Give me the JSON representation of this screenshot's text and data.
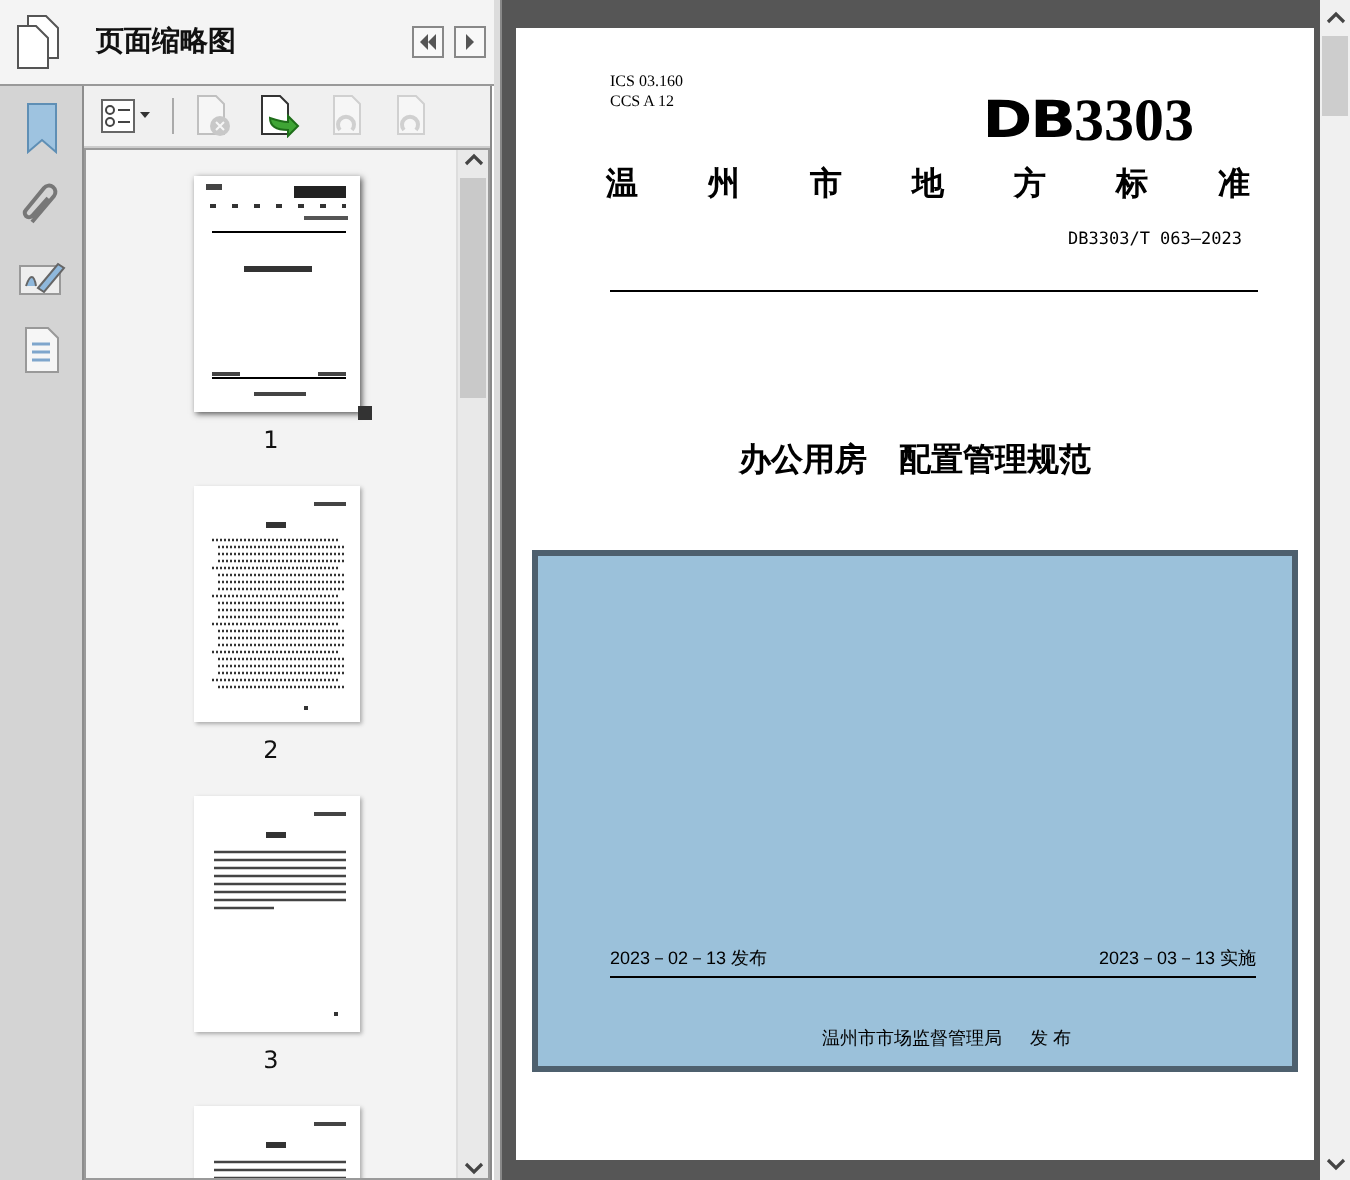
{
  "panel": {
    "title": "页面缩略图"
  },
  "rail_items": [
    {
      "kind": "bookmark"
    },
    {
      "kind": "attachment"
    },
    {
      "kind": "signature"
    },
    {
      "kind": "layers"
    }
  ],
  "tools": [
    {
      "kind": "options",
      "disabled": false
    },
    {
      "kind": "delete",
      "disabled": true
    },
    {
      "kind": "insert",
      "disabled": false
    },
    {
      "kind": "undo",
      "disabled": true
    },
    {
      "kind": "redo",
      "disabled": true
    }
  ],
  "thumbnails": [
    {
      "label": "1",
      "kind": "cover",
      "selected": true
    },
    {
      "label": "2",
      "kind": "toc",
      "selected": false
    },
    {
      "label": "3",
      "kind": "text",
      "selected": false
    },
    {
      "kind": "text",
      "selected": false
    }
  ],
  "document": {
    "ics": "ICS  03.160",
    "ccs": "CCS  A 12",
    "logo_prefix": "DB",
    "logo_number": "3303",
    "heading_chars": [
      "温",
      "州",
      "市",
      "地",
      "方",
      "标",
      "准"
    ],
    "code": "DB3303/T 063—2023",
    "title": "办公用房　配置管理规范",
    "issue_date": "2023－02－13 发布",
    "effective_date": "2023－03－13 实施",
    "publisher": "温州市市场监督管理局",
    "publish_word": "发  布"
  }
}
